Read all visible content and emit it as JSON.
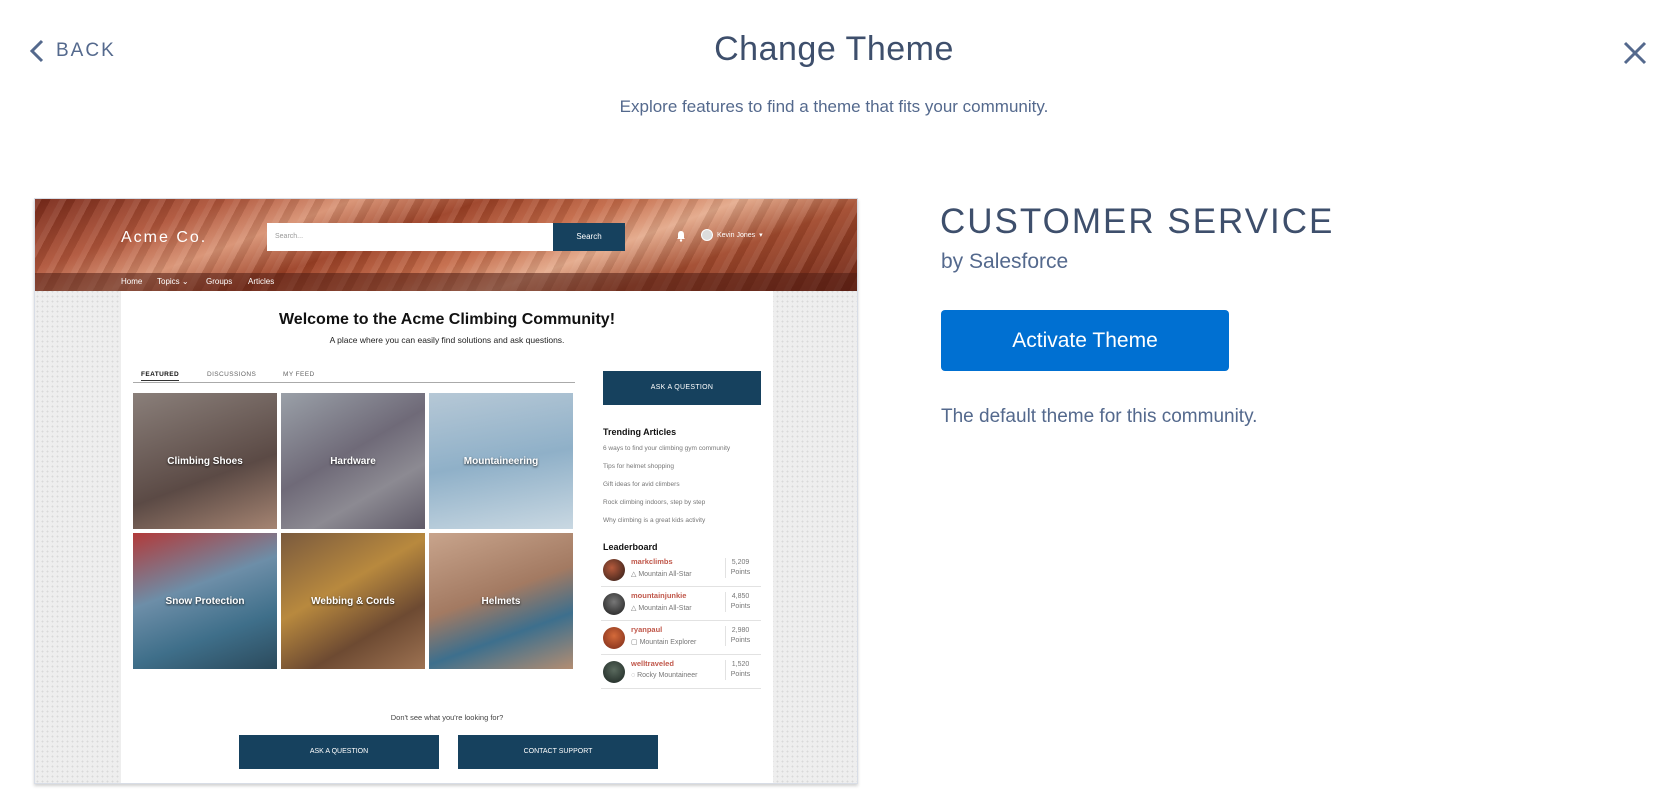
{
  "header": {
    "back_label": "BACK",
    "title": "Change Theme",
    "subtitle": "Explore features to find a theme that fits your community."
  },
  "preview": {
    "brand": "Acme Co.",
    "search_placeholder": "Search...",
    "search_button": "Search",
    "user_name": "Kevin Jones",
    "nav": [
      "Home",
      "Topics",
      "Groups",
      "Articles"
    ],
    "welcome": "Welcome to the Acme Climbing Community!",
    "tagline": "A place where you can easily find solutions and ask questions.",
    "tabs": [
      "FEATURED",
      "DISCUSSIONS",
      "MY FEED"
    ],
    "tiles": [
      "Climbing Shoes",
      "Hardware",
      "Mountaineering",
      "Snow Protection",
      "Webbing & Cords",
      "Helmets"
    ],
    "ask_button": "ASK A QUESTION",
    "trending_title": "Trending Articles",
    "trending": [
      "6 ways to find your climbing gym community",
      "Tips for helmet shopping",
      "Gift ideas for avid climbers",
      "Rock climbing indoors, step by step",
      "Why climbing is a great kids activity"
    ],
    "leaderboard_title": "Leaderboard",
    "leaderboard": [
      {
        "name": "markclimbs",
        "rank": "Mountain All-Star",
        "points": "5,209",
        "unit": "Points"
      },
      {
        "name": "mountainjunkie",
        "rank": "Mountain All-Star",
        "points": "4,850",
        "unit": "Points"
      },
      {
        "name": "ryanpaul",
        "rank": "Mountain Explorer",
        "points": "2,980",
        "unit": "Points"
      },
      {
        "name": "welltraveled",
        "rank": "Rocky Mountaineer",
        "points": "1,520",
        "unit": "Points"
      }
    ],
    "not_found": "Don't see what you're looking for?",
    "bottom_ask": "ASK A QUESTION",
    "bottom_contact": "CONTACT SUPPORT"
  },
  "theme": {
    "name": "CUSTOMER SERVICE",
    "by": "by Salesforce",
    "activate_label": "Activate Theme",
    "description": "The default theme for this community."
  },
  "colors": {
    "accent": "#0070d2",
    "preview_dark": "#16415e",
    "heading": "#3e4f6c",
    "muted": "#54698d"
  }
}
